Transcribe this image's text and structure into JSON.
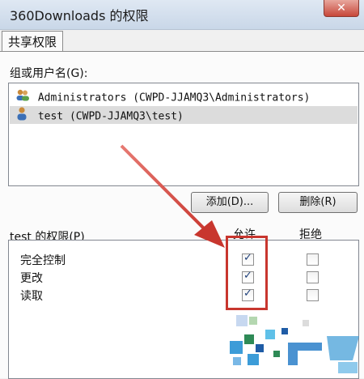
{
  "window": {
    "title": "360Downloads 的权限",
    "close_glyph": "✕"
  },
  "tab": {
    "label": "共享权限"
  },
  "groups": {
    "label": "组或用户名(G):",
    "items": [
      {
        "text": "Administrators (CWPD-JJAMQ3\\Administrators)",
        "icon": "users-group-icon",
        "selected": false
      },
      {
        "text": "test (CWPD-JJAMQ3\\test)",
        "icon": "user-icon",
        "selected": true
      }
    ],
    "add_button": "添加(D)...",
    "remove_button": "删除(R)"
  },
  "permissions": {
    "label": "test 的权限(P)",
    "allow_header": "允许",
    "deny_header": "拒绝",
    "rows": [
      {
        "name": "完全控制",
        "allow": true,
        "deny": false
      },
      {
        "name": "更改",
        "allow": true,
        "deny": false
      },
      {
        "name": "读取",
        "allow": true,
        "deny": false
      }
    ]
  },
  "colors": {
    "annotation_red": "#c8362e",
    "highlight_bg": "#dcdcdc"
  }
}
